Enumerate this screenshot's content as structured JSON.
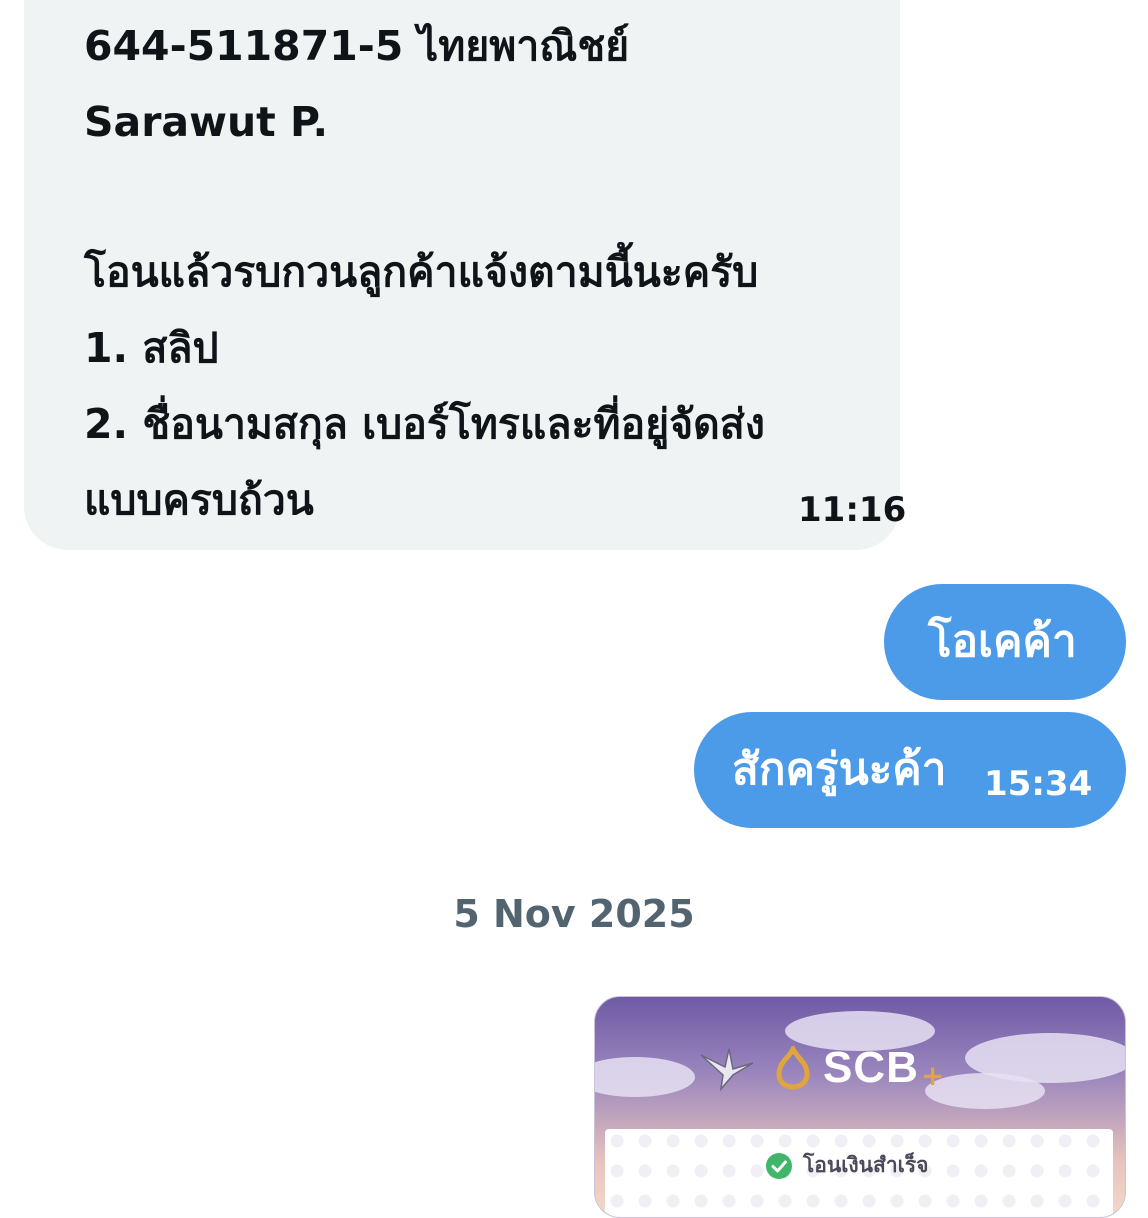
{
  "incoming_message": {
    "lines": [
      "644-511871-5 ไทยพาณิชย์",
      "Sarawut P.",
      "",
      "โอนแล้วรบกวนลูกค้าแจ้งตามนี้นะครับ",
      "1. สลิป",
      "2. ชื่อนามสกุล เบอร์โทรและที่อยู่จัดส่ง",
      "แบบครบถ้วน"
    ],
    "time": "11:16"
  },
  "outgoing_messages": [
    {
      "text": "โอเคค้า",
      "time": ""
    },
    {
      "text": "สักครู่นะค้า",
      "time": "15:34"
    }
  ],
  "date_separator": "5 Nov 2025",
  "slip": {
    "brand": "SCB",
    "brand_suffix": "+",
    "status": "โอนเงินสำเร็จ",
    "colors": {
      "accent": "#e0a53c",
      "success": "#3fb66a"
    }
  },
  "colors": {
    "incoming_bubble": "#eff3f4",
    "outgoing_bubble": "#4c9be8",
    "date_text": "#536471"
  }
}
